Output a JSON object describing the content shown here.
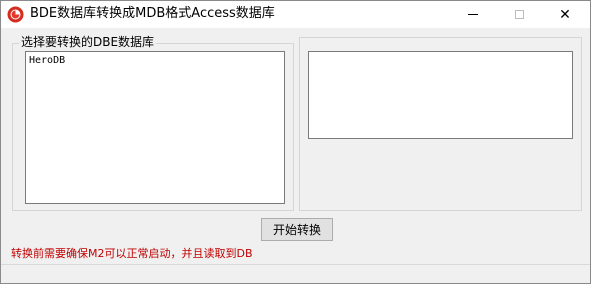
{
  "window": {
    "title": "BDE数据库转换成MDB格式Access数据库"
  },
  "icons": {
    "app": "app-logo-icon",
    "minimize": "minimize-icon",
    "maximize": "maximize-icon",
    "close": "close-icon"
  },
  "glyphs": {
    "close": "✕"
  },
  "left_group": {
    "caption": "选择要转换的DBE数据库",
    "items": [
      "HeroDB"
    ]
  },
  "right_group": {
    "text_value": ""
  },
  "actions": {
    "start_label": "开始转换"
  },
  "warning": {
    "text": "转换前需要确保M2可以正常启动，并且读取到DB",
    "color": "#c00000"
  }
}
